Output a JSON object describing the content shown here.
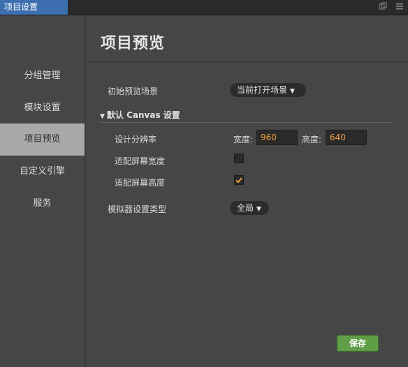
{
  "window": {
    "tab_title": "项目设置",
    "icons": [
      "popout-icon",
      "menu-icon"
    ]
  },
  "sidebar": {
    "items": [
      {
        "label": "分组管理",
        "active": false
      },
      {
        "label": "模块设置",
        "active": false
      },
      {
        "label": "项目预览",
        "active": true
      },
      {
        "label": "自定义引擎",
        "active": false
      },
      {
        "label": "服务",
        "active": false
      }
    ]
  },
  "main": {
    "title": "项目预览",
    "initial_scene": {
      "label": "初始预览场景",
      "value": "当前打开场景"
    },
    "canvas_section": {
      "title": "默认 Canvas 设置",
      "resolution": {
        "label": "设计分辨率",
        "width_label": "宽度:",
        "width_value": "960",
        "height_label": "高度:",
        "height_value": "640"
      },
      "fit_width": {
        "label": "适配屏幕宽度",
        "checked": false
      },
      "fit_height": {
        "label": "适配屏幕高度",
        "checked": true
      }
    },
    "simulator": {
      "label": "模拟器设置类型",
      "value": "全局"
    },
    "save_label": "保存"
  },
  "colors": {
    "accent_tab": "#3d6fb0",
    "save_button": "#5f9e46",
    "input_value": "#f0a040",
    "checkmark": "#f0a040"
  }
}
